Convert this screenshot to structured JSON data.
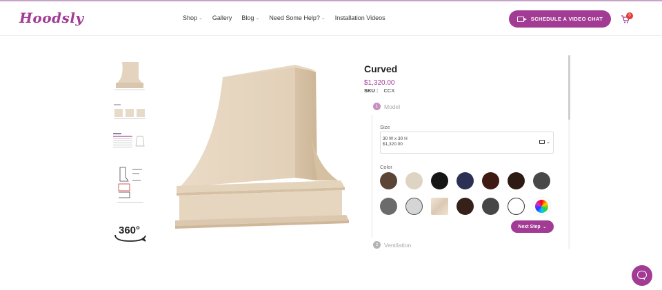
{
  "brand": {
    "logo_text": "Hoodsly",
    "accent": "#a23b93"
  },
  "nav": {
    "items": [
      {
        "label": "Shop",
        "has_dropdown": true
      },
      {
        "label": "Gallery",
        "has_dropdown": false
      },
      {
        "label": "Blog",
        "has_dropdown": true
      },
      {
        "label": "Need Some Help?",
        "has_dropdown": true
      },
      {
        "label": "Installation Videos",
        "has_dropdown": false
      }
    ],
    "cta_label": "SCHEDULE A VIDEO CHAT",
    "cart_count": "0"
  },
  "gallery": {
    "thumb_360_label": "360°"
  },
  "product": {
    "title": "Curved",
    "price": "$1,320.00",
    "sku_label": "SKU :",
    "sku_value": "CCX"
  },
  "steps": [
    {
      "num": "1",
      "label": "Model",
      "active": true
    },
    {
      "num": "2",
      "label": "Ventilation",
      "active": false
    }
  ],
  "model": {
    "size_label": "Size",
    "size_line1": "30 W x 30 H",
    "size_line2": "$1,320.00",
    "color_label": "Color",
    "colors": [
      {
        "name": "walnut",
        "hex": "#5a4537"
      },
      {
        "name": "cream",
        "hex": "#ddd4c4"
      },
      {
        "name": "black",
        "hex": "#151515"
      },
      {
        "name": "navy",
        "hex": "#2c3055"
      },
      {
        "name": "mahogany",
        "hex": "#3e1a12"
      },
      {
        "name": "espresso",
        "hex": "#2d1a12"
      },
      {
        "name": "charcoal",
        "hex": "#484848"
      },
      {
        "name": "slate-gray",
        "hex": "#6b6b6b"
      },
      {
        "name": "light-gray",
        "hex": "#d5d5d5"
      },
      {
        "name": "raw-maple",
        "hex": "#e9dacb"
      },
      {
        "name": "dark-brown",
        "hex": "#35201a"
      },
      {
        "name": "dark-gray",
        "hex": "#464646"
      },
      {
        "name": "white",
        "hex": "#ffffff"
      },
      {
        "name": "custom-color",
        "hex": "rainbow"
      }
    ],
    "next_label": "Next Step"
  }
}
